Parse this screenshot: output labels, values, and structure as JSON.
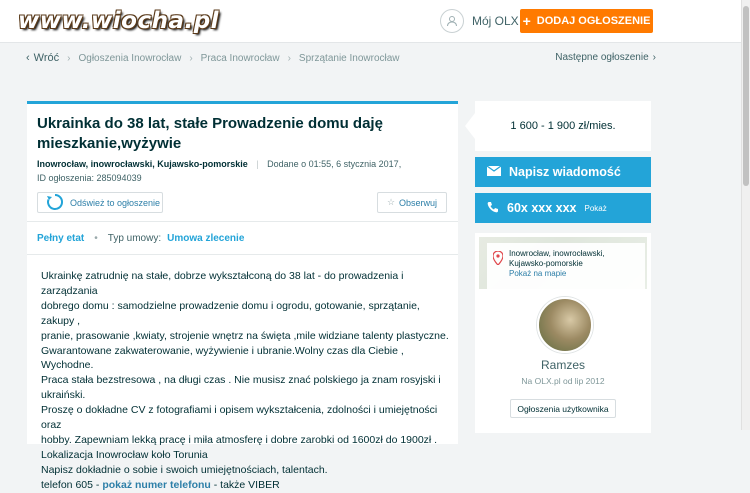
{
  "header": {
    "logo": "www.wiocha.pl",
    "my_olx": "Mój OLX",
    "add_button": "DODAJ OGŁOSZENIE"
  },
  "breadcrumbs": {
    "back": "Wróć",
    "items": [
      "Ogłoszenia Inowrocław",
      "Praca Inowrocław",
      "Sprzątanie Inowrocław"
    ],
    "next": "Następne ogłoszenie"
  },
  "ad": {
    "title": "Ukrainka do 38 lat, stałe Prowadzenie domu daję mieszkanie,wyżywie",
    "location": "Inowrocław, inowrocławski, Kujawsko-pomorskie",
    "added": "Dodane o 01:55, 6 stycznia 2017,",
    "ad_id": "ID ogłoszenia: 285094039",
    "refresh_label": "Odśwież to ogłoszenie",
    "observe_label": "Obserwuj",
    "tag_full_time": "Pełny etat",
    "contract_label": "Typ umowy:",
    "contract_value": "Umowa zlecenie",
    "description_lines": [
      "Ukrainkę zatrudnię na stałe, dobrze wykształconą do 38 lat - do prowadzenia i zarządzania",
      "dobrego domu : samodzielne prowadzenie domu i ogrodu, gotowanie, sprzątanie, zakupy ,",
      "pranie, prasowanie ,kwiaty, strojenie wnętrz na święta ,mile widziane talenty plastyczne.",
      "Gwarantowane zakwaterowanie, wyżywienie i ubranie.Wolny czas dla Ciebie , Wychodne.",
      "Praca stała bezstresowa , na długi czas . Nie musisz znać polskiego ja znam rosyjski i ukraiński.",
      "Proszę o dokładne CV z fotografiami i opisem wykształcenia, zdolności i umiejętności oraz",
      "hobby. Zapewniam lekką pracę i miła atmosferę i dobre zarobki od 1600zł do 1900zł .",
      "Lokalizacja Inowrocław koło Torunia",
      "Napisz dokładnie o sobie i swoich umiejętnościach, talentach."
    ],
    "phone_prefix": "telefon 605 -",
    "phone_link": "pokaż numer telefonu",
    "phone_suffix": "- także VIBER"
  },
  "sidebar": {
    "price": "1 600 - 1 900 zł/mies.",
    "write_message": "Napisz wiadomość",
    "phone_masked": "60x xxx xxx",
    "phone_show": "Pokaż",
    "map_location_line1": "Inowrocław, inowrocławski,",
    "map_location_line2": "Kujawsko-pomorskie",
    "map_link": "Pokaż na mapie",
    "user_name": "Ramzes",
    "user_since": "Na OLX.pl od lip 2012",
    "user_ads": "Ogłoszenia użytkownika"
  },
  "colors": {
    "accent": "#23a4d8",
    "orange": "#ff7a00"
  }
}
